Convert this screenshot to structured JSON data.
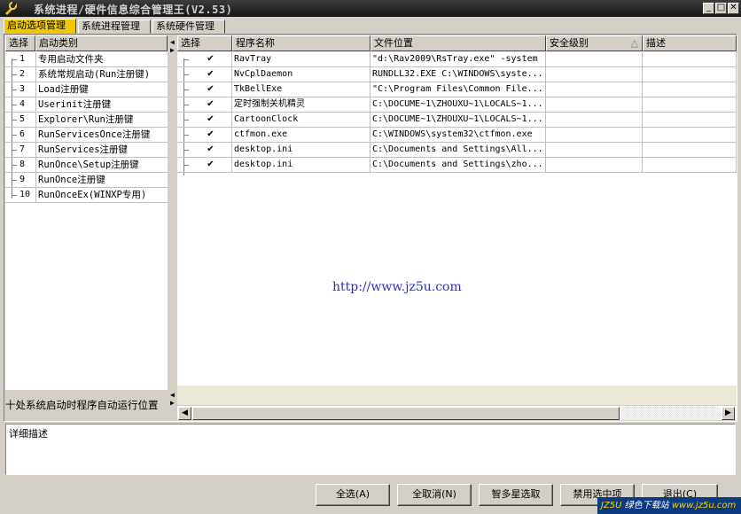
{
  "window": {
    "title": "系统进程/硬件信息综合管理王(V2.53)",
    "min_glyph": "_",
    "max_glyph": "□",
    "close_glyph": "✕"
  },
  "tabs": [
    {
      "label": "启动选项管理",
      "active": true
    },
    {
      "label": "系统进程管理",
      "active": false
    },
    {
      "label": "系统硬件管理",
      "active": false
    }
  ],
  "left_grid": {
    "headers": [
      "选择",
      "启动类别"
    ],
    "rows": [
      {
        "num": "1",
        "name": "专用启动文件夹"
      },
      {
        "num": "2",
        "name": "系统常规启动(Run注册键)"
      },
      {
        "num": "3",
        "name": "Load注册键"
      },
      {
        "num": "4",
        "name": "Userinit注册键"
      },
      {
        "num": "5",
        "name": "Explorer\\Run注册键"
      },
      {
        "num": "6",
        "name": "RunServicesOnce注册键"
      },
      {
        "num": "7",
        "name": "RunServices注册键"
      },
      {
        "num": "8",
        "name": "RunOnce\\Setup注册键"
      },
      {
        "num": "9",
        "name": "RunOnce注册键"
      },
      {
        "num": "10",
        "name": "RunOnceEx(WINXP专用)"
      }
    ],
    "footer": "十处系统启动时程序自动运行位置"
  },
  "right_grid": {
    "headers": [
      "选择",
      "程序名称",
      "文件位置",
      "安全级别",
      "描述"
    ],
    "sort_glyph": "△",
    "check_glyph": "✔",
    "rows": [
      {
        "checked": true,
        "name": "RavTray",
        "path": "\"d:\\Rav2009\\RsTray.exe\" -system",
        "level": "",
        "desc": ""
      },
      {
        "checked": true,
        "name": "NvCplDaemon",
        "path": "RUNDLL32.EXE C:\\WINDOWS\\syste...",
        "level": "",
        "desc": ""
      },
      {
        "checked": true,
        "name": "TkBellExe",
        "path": "\"C:\\Program Files\\Common File...",
        "level": "",
        "desc": ""
      },
      {
        "checked": true,
        "name": "定时强制关机精灵",
        "path": "C:\\DOCUME~1\\ZHOUXU~1\\LOCALS~1...",
        "level": "",
        "desc": ""
      },
      {
        "checked": true,
        "name": "CartoonClock",
        "path": "C:\\DOCUME~1\\ZHOUXU~1\\LOCALS~1...",
        "level": "",
        "desc": ""
      },
      {
        "checked": true,
        "name": "ctfmon.exe",
        "path": "C:\\WINDOWS\\system32\\ctfmon.exe",
        "level": "",
        "desc": ""
      },
      {
        "checked": true,
        "name": "desktop.ini",
        "path": "C:\\Documents and Settings\\All...",
        "level": "",
        "desc": ""
      },
      {
        "checked": true,
        "name": "desktop.ini",
        "path": "C:\\Documents and Settings\\zho...",
        "level": "",
        "desc": ""
      }
    ],
    "watermark_url": "http://www.jz5u.com"
  },
  "detail": {
    "label": "详细描述"
  },
  "buttons": {
    "select_all": "全选(A)",
    "deselect_all": "全取消(N)",
    "smart_select": "智多星选取",
    "disable_selected": "禁用选中项",
    "exit": "退出(C)"
  },
  "brand": {
    "prefix": "JZ5U",
    "middle": "绿色下载站",
    "suffix": "www.jz5u.com"
  },
  "colors": {
    "active_tab": "#f0c800",
    "title_bar": "#202020",
    "url_text": "#3030c0"
  }
}
